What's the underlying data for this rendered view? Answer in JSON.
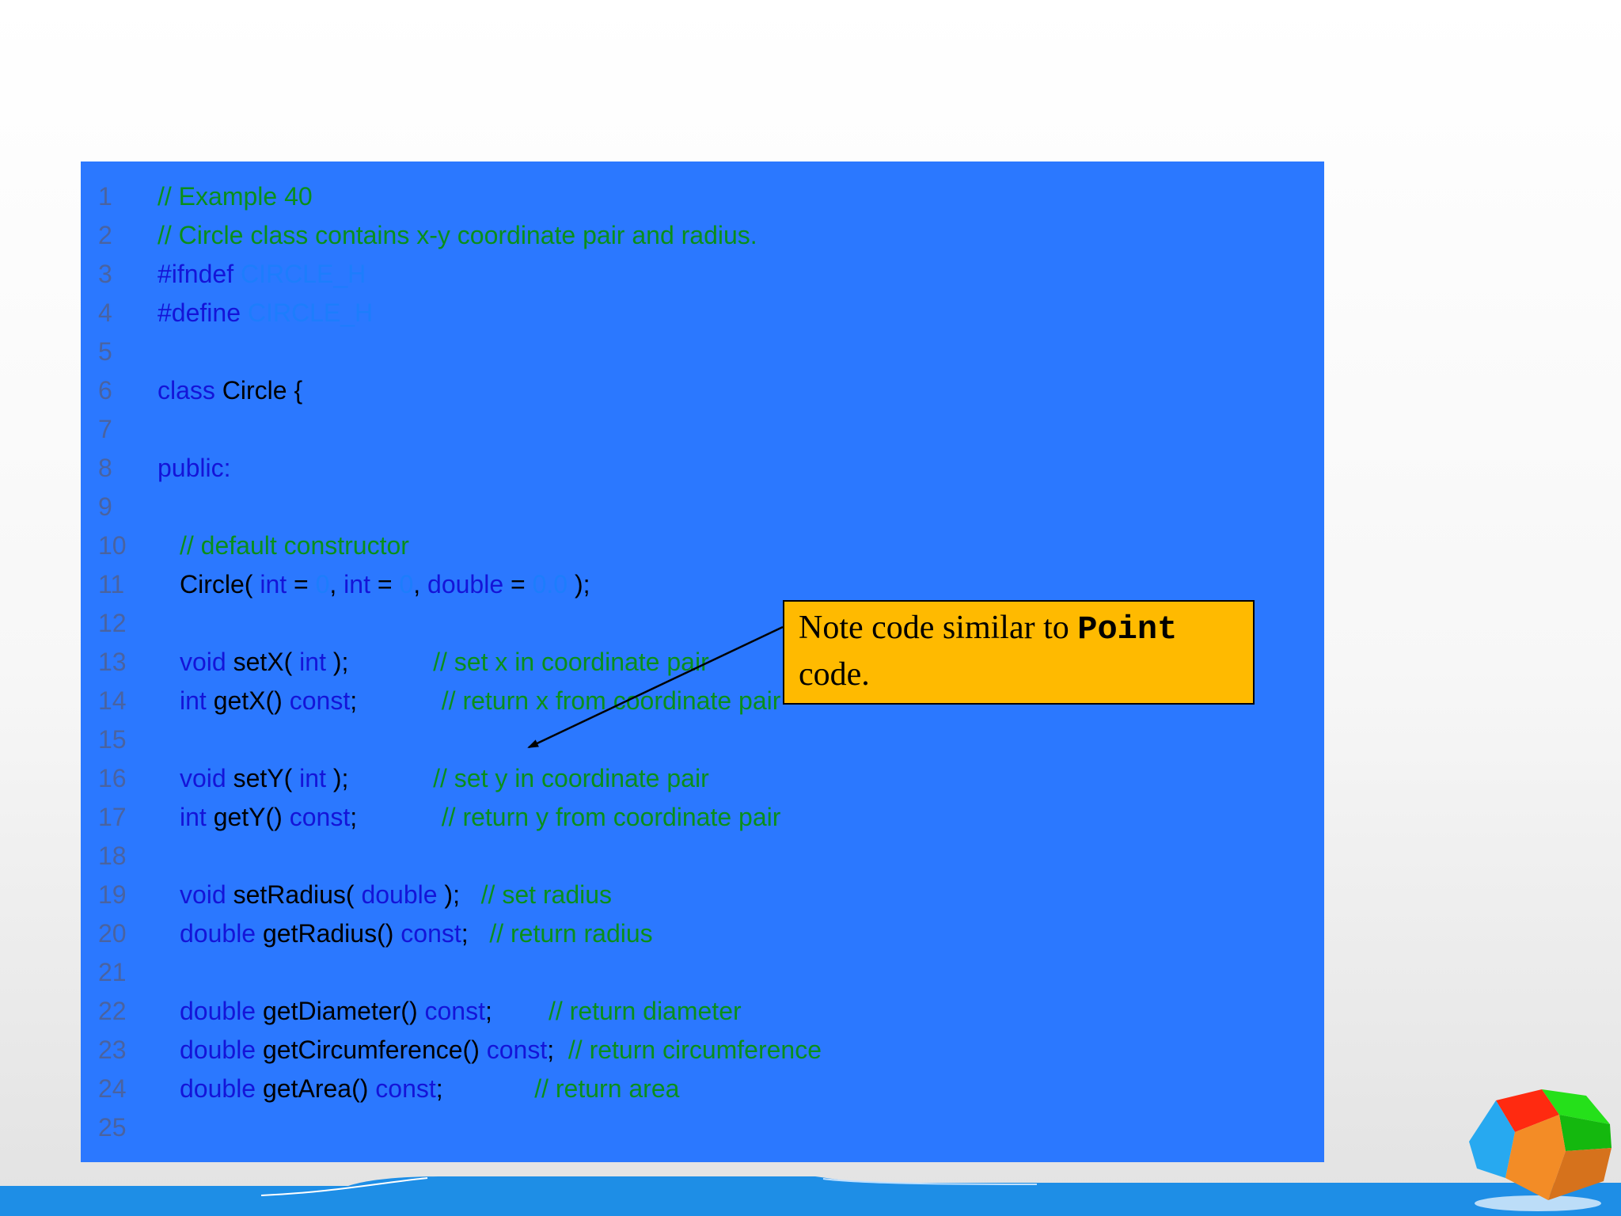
{
  "code": {
    "lines": [
      {
        "n": "1",
        "tokens": [
          [
            "comment",
            "// Example 40"
          ]
        ]
      },
      {
        "n": "2",
        "tokens": [
          [
            "comment",
            "// Circle class contains x-y coordinate pair and radius."
          ]
        ]
      },
      {
        "n": "3",
        "tokens": [
          [
            "kw",
            "#ifndef "
          ],
          [
            "num",
            "CIRCLE_H"
          ]
        ]
      },
      {
        "n": "4",
        "tokens": [
          [
            "kw",
            "#define "
          ],
          [
            "num",
            "CIRCLE_H"
          ]
        ]
      },
      {
        "n": "5",
        "tokens": []
      },
      {
        "n": "6",
        "tokens": [
          [
            "kw",
            "class "
          ],
          [
            "id",
            "Circle {"
          ]
        ]
      },
      {
        "n": "7",
        "tokens": []
      },
      {
        "n": "8",
        "tokens": [
          [
            "kw",
            "public:"
          ]
        ]
      },
      {
        "n": "9",
        "tokens": []
      },
      {
        "n": "10",
        "indent": true,
        "tokens": [
          [
            "comment",
            "// default constructor"
          ]
        ]
      },
      {
        "n": "11",
        "indent": true,
        "tokens": [
          [
            "id",
            "Circle( "
          ],
          [
            "kw",
            "int"
          ],
          [
            "id",
            " = "
          ],
          [
            "num",
            "0"
          ],
          [
            "id",
            ", "
          ],
          [
            "kw",
            "int"
          ],
          [
            "id",
            " = "
          ],
          [
            "num",
            "0"
          ],
          [
            "id",
            ", "
          ],
          [
            "kw",
            "double"
          ],
          [
            "id",
            " = "
          ],
          [
            "num",
            "0.0"
          ],
          [
            "id",
            " );"
          ]
        ]
      },
      {
        "n": "12",
        "tokens": []
      },
      {
        "n": "13",
        "indent": true,
        "tokens": [
          [
            "kw",
            "void "
          ],
          [
            "id",
            "setX( "
          ],
          [
            "kw",
            "int"
          ],
          [
            "id",
            " );            "
          ],
          [
            "comment",
            "// set x in coordinate pair"
          ]
        ]
      },
      {
        "n": "14",
        "indent": true,
        "tokens": [
          [
            "kw",
            "int "
          ],
          [
            "id",
            "getX() "
          ],
          [
            "kw",
            "const"
          ],
          [
            "id",
            ";            "
          ],
          [
            "comment",
            "// return x from coordinate pair"
          ]
        ]
      },
      {
        "n": "15",
        "tokens": []
      },
      {
        "n": "16",
        "indent": true,
        "tokens": [
          [
            "kw",
            "void "
          ],
          [
            "id",
            "setY( "
          ],
          [
            "kw",
            "int"
          ],
          [
            "id",
            " );            "
          ],
          [
            "comment",
            "// set y in coordinate pair"
          ]
        ]
      },
      {
        "n": "17",
        "indent": true,
        "tokens": [
          [
            "kw",
            "int "
          ],
          [
            "id",
            "getY() "
          ],
          [
            "kw",
            "const"
          ],
          [
            "id",
            ";            "
          ],
          [
            "comment",
            "// return y from coordinate pair"
          ]
        ]
      },
      {
        "n": "18",
        "tokens": []
      },
      {
        "n": "19",
        "indent": true,
        "tokens": [
          [
            "kw",
            "void "
          ],
          [
            "id",
            "setRadius( "
          ],
          [
            "kw",
            "double"
          ],
          [
            "id",
            " );   "
          ],
          [
            "comment",
            "// set radius"
          ]
        ]
      },
      {
        "n": "20",
        "indent": true,
        "tokens": [
          [
            "kw",
            "double "
          ],
          [
            "id",
            "getRadius() "
          ],
          [
            "kw",
            "const"
          ],
          [
            "id",
            ";   "
          ],
          [
            "comment",
            "// return radius"
          ]
        ]
      },
      {
        "n": "21",
        "tokens": []
      },
      {
        "n": "22",
        "indent": true,
        "tokens": [
          [
            "kw",
            "double "
          ],
          [
            "id",
            "getDiameter() "
          ],
          [
            "kw",
            "const"
          ],
          [
            "id",
            ";        "
          ],
          [
            "comment",
            "// return diameter"
          ]
        ]
      },
      {
        "n": "23",
        "indent": true,
        "tokens": [
          [
            "kw",
            "double "
          ],
          [
            "id",
            "getCircumference() "
          ],
          [
            "kw",
            "const"
          ],
          [
            "id",
            ";  "
          ],
          [
            "comment",
            "// return circumference"
          ]
        ]
      },
      {
        "n": "24",
        "indent": true,
        "tokens": [
          [
            "kw",
            "double "
          ],
          [
            "id",
            "getArea() "
          ],
          [
            "kw",
            "const"
          ],
          [
            "id",
            ";             "
          ],
          [
            "comment",
            "// return area"
          ]
        ]
      },
      {
        "n": "25",
        "tokens": []
      }
    ]
  },
  "note": {
    "text_before": "Note code similar to ",
    "code_word": "Point",
    "text_after": "code."
  },
  "colors": {
    "panel": "#2b78ff",
    "comment": "#0a8f1a",
    "keyword": "#1414d8",
    "identifier": "#000000",
    "number": "#1d7dfc",
    "line_number": "#4a63a0",
    "note_background": "#ffba00",
    "footer": "#1e8ee6"
  },
  "decorations": {
    "logo_icon": "colored-cube-icon",
    "footer_icon": "wave-footer"
  }
}
